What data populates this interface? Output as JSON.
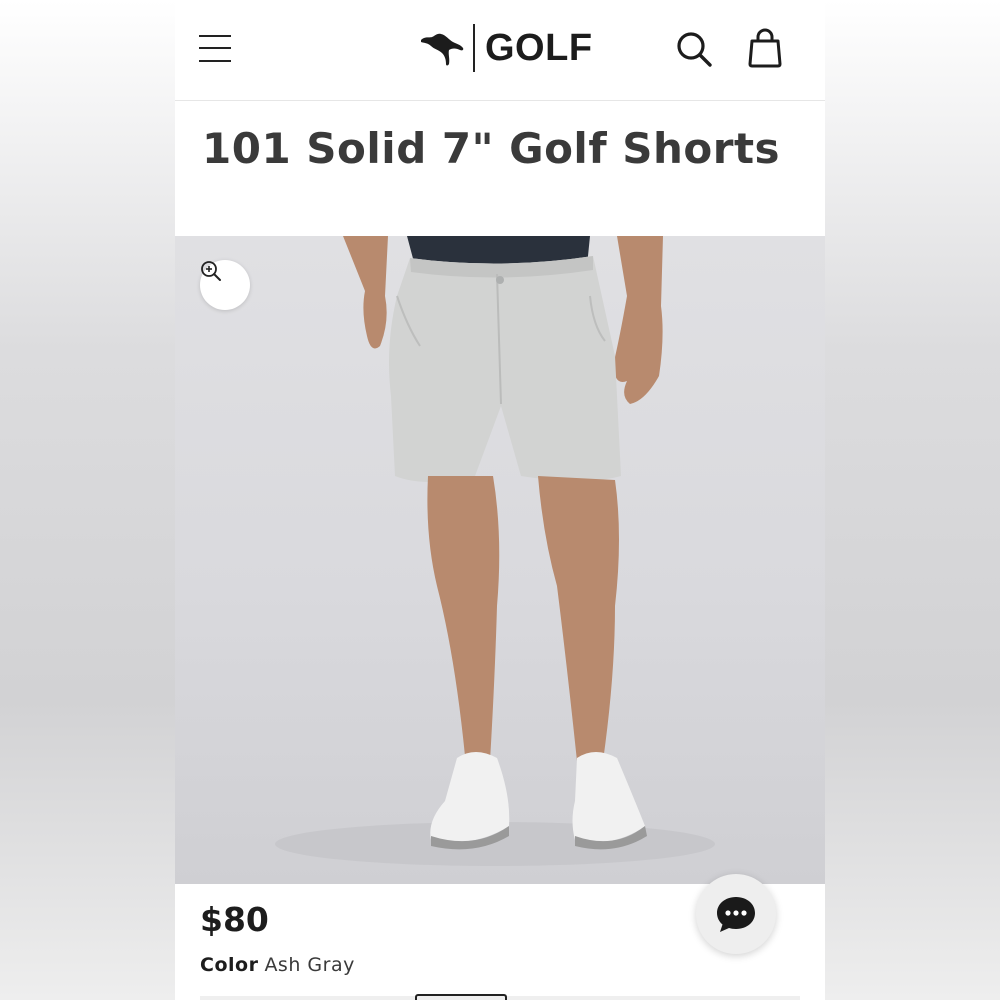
{
  "brand": {
    "logo_text": "GOLF",
    "logo_mark": "puma-cat-logo"
  },
  "header": {
    "menu_icon": "hamburger-menu-icon",
    "search_icon": "search-icon",
    "bag_icon": "shopping-bag-icon"
  },
  "product": {
    "title": "101 Solid 7\" Golf Shorts",
    "price": "$80",
    "color_label": "Color",
    "color_value": "Ash Gray",
    "image_alt": "Model wearing light gray golf shorts with white golf shoes"
  },
  "actions": {
    "zoom_icon": "zoom-in-icon",
    "chat_icon": "chat-bubble-icon"
  },
  "colors": {
    "text_primary": "#1d1d1d",
    "title_text": "#3a3a3a",
    "image_bg": "#dcdce0",
    "shorts": "#d2d3d2",
    "shirt": "#2a313c",
    "skin": "#b88a6e"
  }
}
